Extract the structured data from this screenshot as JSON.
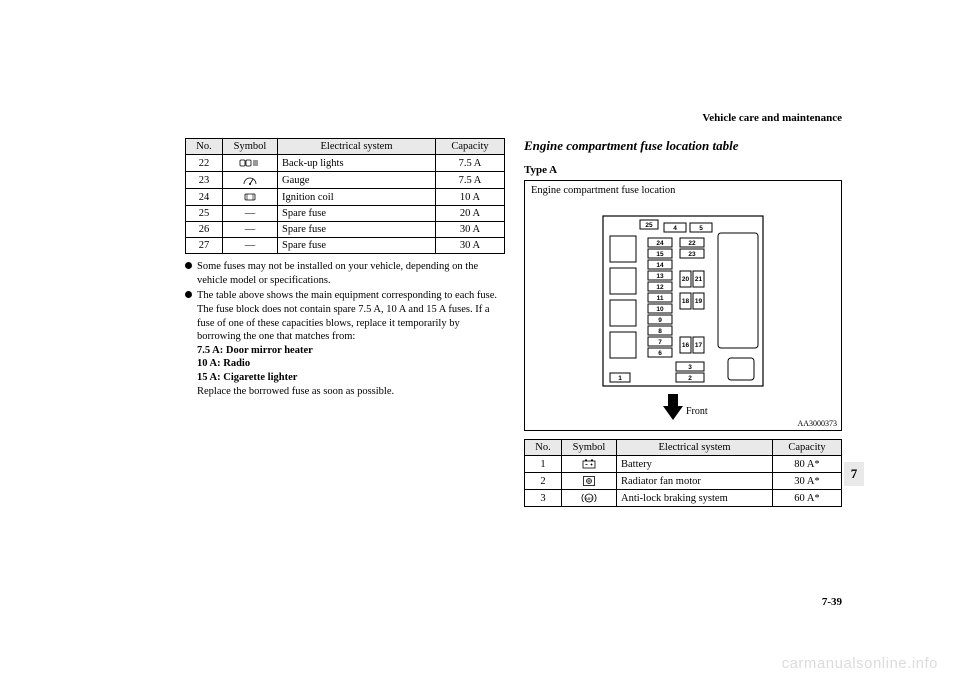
{
  "header": {
    "running_head": "Vehicle care and maintenance"
  },
  "left_table": {
    "headers": {
      "no": "No.",
      "symbol": "Symbol",
      "system": "Electrical system",
      "capacity": "Capacity"
    },
    "rows": [
      {
        "no": "22",
        "symbol": "backup-lights",
        "system": "Back-up lights",
        "capacity": "7.5 A"
      },
      {
        "no": "23",
        "symbol": "gauge",
        "system": "Gauge",
        "capacity": "7.5 A"
      },
      {
        "no": "24",
        "symbol": "ignition-coil",
        "system": "Ignition coil",
        "capacity": "10 A"
      },
      {
        "no": "25",
        "symbol": "dash",
        "system": "Spare fuse",
        "capacity": "20 A"
      },
      {
        "no": "26",
        "symbol": "dash",
        "system": "Spare fuse",
        "capacity": "30 A"
      },
      {
        "no": "27",
        "symbol": "dash",
        "system": "Spare fuse",
        "capacity": "30 A"
      }
    ]
  },
  "notes": {
    "b1": "Some fuses may not be installed on your vehicle, depending on the vehicle model or specifications.",
    "b2": "The table above shows the main equipment corresponding to each fuse.",
    "p1": "The fuse block does not contain spare 7.5 A, 10 A and 15 A fuses. If a fuse of one of these capacities blows, replace it temporarily by borrowing the one that matches from:",
    "l1": "7.5 A: Door mirror heater",
    "l2": "10 A: Radio",
    "l3": "15 A: Cigarette lighter",
    "p2": "Replace the borrowed fuse as soon as possible."
  },
  "right": {
    "heading": "Engine compartment fuse location table",
    "type_label": "Type A",
    "diagram_caption": "Engine compartment fuse location",
    "front_label": "Front",
    "diagram_id": "AA3000373",
    "fuse_numbers": [
      "1",
      "2",
      "3",
      "4",
      "5",
      "6",
      "7",
      "8",
      "9",
      "10",
      "11",
      "12",
      "13",
      "14",
      "15",
      "16",
      "17",
      "18",
      "19",
      "20",
      "21",
      "22",
      "23",
      "24",
      "25"
    ]
  },
  "right_table": {
    "headers": {
      "no": "No.",
      "symbol": "Symbol",
      "system": "Electrical system",
      "capacity": "Capacity"
    },
    "rows": [
      {
        "no": "1",
        "symbol": "battery",
        "system": "Battery",
        "capacity": "80 A*"
      },
      {
        "no": "2",
        "symbol": "fan",
        "system": "Radiator fan motor",
        "capacity": "30 A*"
      },
      {
        "no": "3",
        "symbol": "abs",
        "system": "Anti-lock braking system",
        "capacity": "60 A*"
      }
    ]
  },
  "section_tab": "7",
  "page_number": "7-39",
  "watermark": "carmanualsonline.info",
  "symbols_dash": "—"
}
